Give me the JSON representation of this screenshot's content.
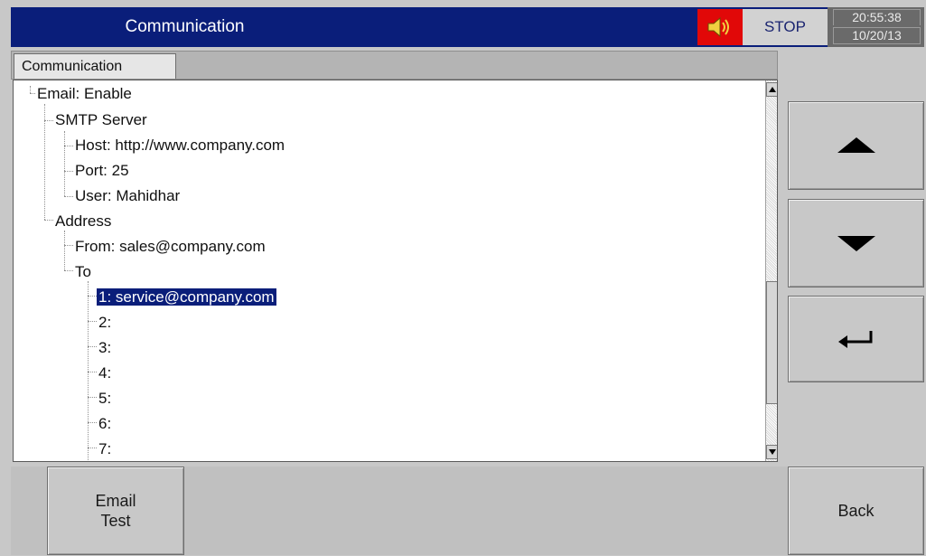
{
  "header": {
    "title": "Communication",
    "status": "STOP",
    "time": "20:55:38",
    "date": "10/20/13",
    "speaker_icon": "speaker-icon",
    "speaker_color": "#e10808"
  },
  "tab": {
    "label": "Communication"
  },
  "tree": {
    "items": [
      "Email: Enable",
      "SMTP Server",
      "Host: http://www.company.com",
      "Port: 25",
      "User: Mahidhar",
      "Address",
      "From: sales@company.com",
      "To",
      "1: service@company.com",
      "2:",
      "3:",
      "4:",
      "5:",
      "6:",
      "7:"
    ],
    "selected_index": 8
  },
  "scrollbar": {
    "up_icon": "scroll-up-arrow-icon",
    "down_icon": "scroll-down-arrow-icon"
  },
  "side_buttons": {
    "up_icon": "arrow-up-icon",
    "down_icon": "arrow-down-icon",
    "enter_icon": "enter-icon"
  },
  "bottom": {
    "email_test_line1": "Email",
    "email_test_line2": "Test",
    "back_label": "Back"
  },
  "colors": {
    "title_bar": "#0a1e7a",
    "selection": "#0a1e7a",
    "background": "#c8c8c8"
  }
}
